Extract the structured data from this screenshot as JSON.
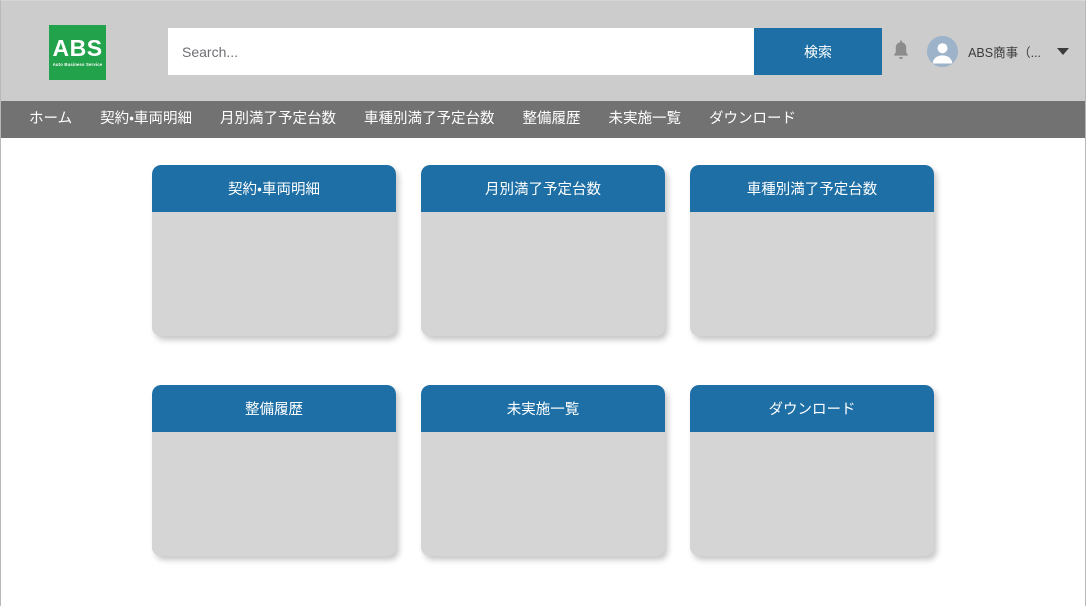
{
  "header": {
    "logo": {
      "main": "ABS",
      "sub": "Auto Business Service",
      "color": "#22a24a"
    },
    "search": {
      "placeholder": "Search...",
      "value": "",
      "button_label": "検索"
    },
    "notifications_icon": "bell-icon",
    "user": {
      "name": "ABS商事（...",
      "avatar_icon": "person-avatar-icon",
      "caret_icon": "chevron-down-icon"
    },
    "background": "#cccccc"
  },
  "nav": {
    "background": "#727272",
    "items": [
      {
        "label": "ホーム",
        "name": "home"
      },
      {
        "label": "契約・車両明細",
        "name": "contract-vehicle-details"
      },
      {
        "label": "月別満了予定台数",
        "name": "monthly-expiry-count"
      },
      {
        "label": "車種別満了予定台数",
        "name": "model-expiry-count"
      },
      {
        "label": "整備履歴",
        "name": "maintenance-history"
      },
      {
        "label": "未実施一覧",
        "name": "not-implemented-list"
      },
      {
        "label": "ダウンロード",
        "name": "download"
      }
    ]
  },
  "main": {
    "accent_color": "#1d6fa5",
    "card_body_color": "#d5d5d5",
    "cards": [
      {
        "title": "契約・車両明細",
        "name": "contract-vehicle-details"
      },
      {
        "title": "月別満了予定台数",
        "name": "monthly-expiry-count"
      },
      {
        "title": "車種別満了予定台数",
        "name": "model-expiry-count"
      },
      {
        "title": "整備履歴",
        "name": "maintenance-history"
      },
      {
        "title": "未実施一覧",
        "name": "not-implemented-list"
      },
      {
        "title": "ダウンロード",
        "name": "download"
      }
    ]
  }
}
